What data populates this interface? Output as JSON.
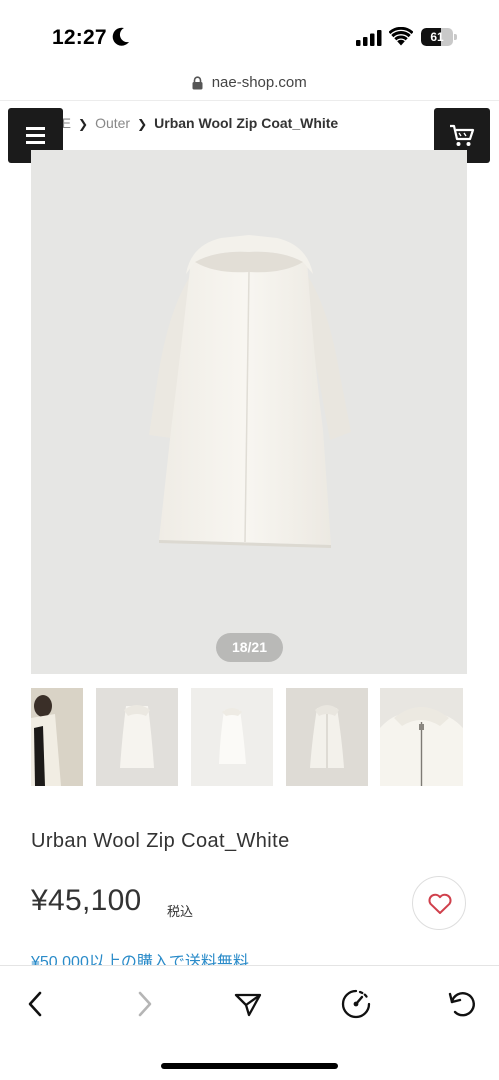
{
  "status_bar": {
    "time": "12:27",
    "battery_level": "61",
    "battery_fraction": 0.61
  },
  "browser": {
    "url": "nae-shop.com"
  },
  "breadcrumb": {
    "items": [
      "ME",
      "Outer"
    ],
    "current": "Urban Wool Zip Coat_White"
  },
  "gallery": {
    "counter": "18/21",
    "current_index": 18,
    "total": 21,
    "thumbnail_count": 5
  },
  "product": {
    "title": "Urban Wool Zip Coat_White",
    "price": "¥45,100",
    "tax_label": "税込",
    "shipping_note": "¥50,000以上の購入で送料無料"
  },
  "icons": {
    "menu": "hamburger-icon",
    "cart": "cart-icon",
    "favorite": "heart-icon",
    "back": "chevron-left-icon",
    "forward": "chevron-right-icon",
    "share": "send-icon",
    "speed": "gauge-icon",
    "reload": "reload-icon"
  },
  "colors": {
    "header_button_bg": "#1b1b1b",
    "link_blue": "#2a8bc9",
    "heart_red": "#d0404c",
    "image_bg": "#e6e6e4",
    "coat_white": "#f6f4ee"
  }
}
